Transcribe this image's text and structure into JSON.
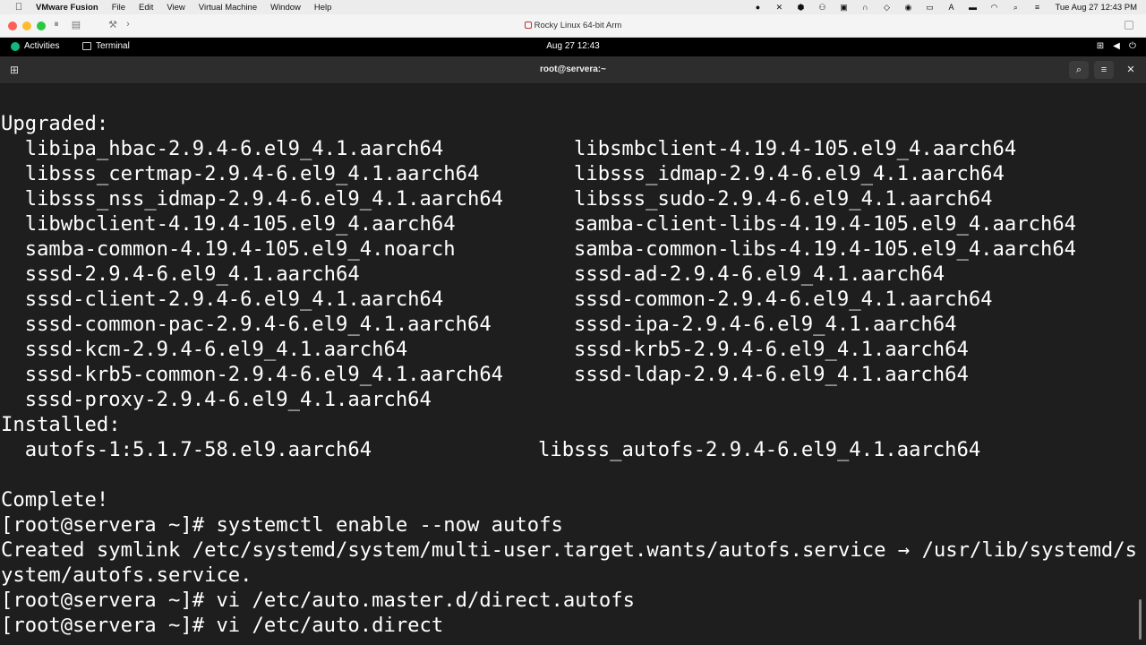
{
  "mac_menubar": {
    "app_name": "VMware Fusion",
    "menus": [
      "File",
      "Edit",
      "View",
      "Virtual Machine",
      "Window",
      "Help"
    ],
    "clock": "Tue Aug 27  12:43 PM"
  },
  "vm_window": {
    "title": "Rocky Linux 64-bit Arm"
  },
  "gnome_bar": {
    "activities": "Activities",
    "app": "Terminal",
    "clock": "Aug 27  12:43"
  },
  "terminal": {
    "title": "root@servera:~",
    "lines": [
      {
        "text": "Upgraded:"
      },
      {
        "text": "  libipa_hbac-2.9.4-6.el9_4.1.aarch64",
        "col2": "libsmbclient-4.19.4-105.el9_4.aarch64"
      },
      {
        "text": "  libsss_certmap-2.9.4-6.el9_4.1.aarch64",
        "col2": "libsss_idmap-2.9.4-6.el9_4.1.aarch64"
      },
      {
        "text": "  libsss_nss_idmap-2.9.4-6.el9_4.1.aarch64",
        "col2": "libsss_sudo-2.9.4-6.el9_4.1.aarch64"
      },
      {
        "text": "  libwbclient-4.19.4-105.el9_4.aarch64",
        "col2": "samba-client-libs-4.19.4-105.el9_4.aarch64"
      },
      {
        "text": "  samba-common-4.19.4-105.el9_4.noarch",
        "col2": "samba-common-libs-4.19.4-105.el9_4.aarch64"
      },
      {
        "text": "  sssd-2.9.4-6.el9_4.1.aarch64",
        "col2": "sssd-ad-2.9.4-6.el9_4.1.aarch64"
      },
      {
        "text": "  sssd-client-2.9.4-6.el9_4.1.aarch64",
        "col2": "sssd-common-2.9.4-6.el9_4.1.aarch64"
      },
      {
        "text": "  sssd-common-pac-2.9.4-6.el9_4.1.aarch64",
        "col2": "sssd-ipa-2.9.4-6.el9_4.1.aarch64"
      },
      {
        "text": "  sssd-kcm-2.9.4-6.el9_4.1.aarch64",
        "col2": "sssd-krb5-2.9.4-6.el9_4.1.aarch64"
      },
      {
        "text": "  sssd-krb5-common-2.9.4-6.el9_4.1.aarch64",
        "col2": "sssd-ldap-2.9.4-6.el9_4.1.aarch64"
      },
      {
        "text": "  sssd-proxy-2.9.4-6.el9_4.1.aarch64"
      },
      {
        "text": "Installed:"
      },
      {
        "text": "  autofs-1:5.1.7-58.el9.aarch64",
        "col2": "libsss_autofs-2.9.4-6.el9_4.1.aarch64",
        "col2_alt": true
      },
      {
        "text": ""
      },
      {
        "text": "Complete!"
      },
      {
        "text": "[root@servera ~]# systemctl enable --now autofs"
      },
      {
        "text": "Created symlink /etc/systemd/system/multi-user.target.wants/autofs.service → /usr/lib/systemd/s"
      },
      {
        "text": "ystem/autofs.service."
      },
      {
        "text": "[root@servera ~]# vi /etc/auto.master.d/direct.autofs"
      },
      {
        "text": "[root@servera ~]# vi /etc/auto.direct"
      }
    ]
  },
  "colors": {
    "terminal_bg": "#1e1e1e",
    "terminal_fg": "#ffffff",
    "header_bg": "#2d2d2d",
    "gnome_bar_bg": "#000000",
    "traffic_red": "#ff5f57",
    "traffic_yellow": "#febc2e",
    "traffic_green": "#28c840"
  }
}
